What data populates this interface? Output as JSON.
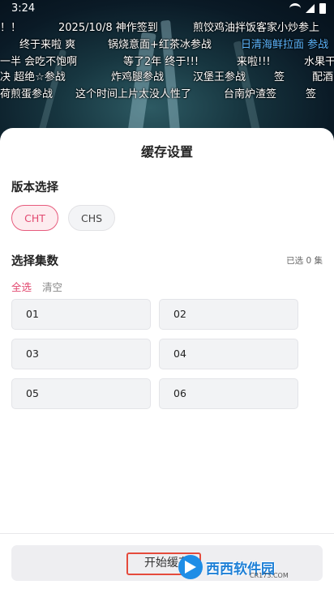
{
  "status_bar": {
    "time": "3:24"
  },
  "danmaku": [
    {
      "text": "！！",
      "color": "white"
    },
    {
      "text": "2025/10/8 神作签到",
      "color": "white"
    },
    {
      "text": "煎饺鸡油拌饭客家小炒参上",
      "color": "white"
    },
    {
      "text": "终于来啦 爽",
      "color": "white"
    },
    {
      "text": "锅烧意面+红茶冰参战",
      "color": "white"
    },
    {
      "text": "日清海鲜拉面 参战",
      "color": "blue"
    },
    {
      "text": "一半 会吃不饱啊",
      "color": "white"
    },
    {
      "text": "等了2年 终于!!!",
      "color": "white"
    },
    {
      "text": "来啦!!!",
      "color": "white"
    },
    {
      "text": "水果干",
      "color": "white"
    },
    {
      "text": "决 超绝☆参战",
      "color": "white"
    },
    {
      "text": "炸鸡腿参战",
      "color": "white"
    },
    {
      "text": "汉堡王参战",
      "color": "white"
    },
    {
      "text": "签",
      "color": "white"
    },
    {
      "text": "配酒",
      "color": "white"
    },
    {
      "text": "荷煎蛋参战",
      "color": "white"
    },
    {
      "text": "这个时间上片太没人性了",
      "color": "white"
    },
    {
      "text": "台南炉渣签",
      "color": "white"
    },
    {
      "text": "签",
      "color": "white"
    }
  ],
  "sheet": {
    "title": "缓存设置",
    "version_section": {
      "title": "版本选择",
      "options": [
        {
          "label": "CHT",
          "selected": true
        },
        {
          "label": "CHS",
          "selected": false
        }
      ]
    },
    "episodes_section": {
      "title": "选择集数",
      "selected_count": "已选 0 集",
      "select_all": "全选",
      "clear": "清空",
      "episodes": [
        "01",
        "02",
        "03",
        "04",
        "05",
        "06"
      ]
    },
    "start_button": "开始缓存"
  },
  "watermark": {
    "text": "西西软件园",
    "url": "CR173.COM"
  },
  "colors": {
    "accent": "#e24970",
    "highlight_box": "#e54a3c",
    "danmaku_blue": "#5db7ff"
  }
}
